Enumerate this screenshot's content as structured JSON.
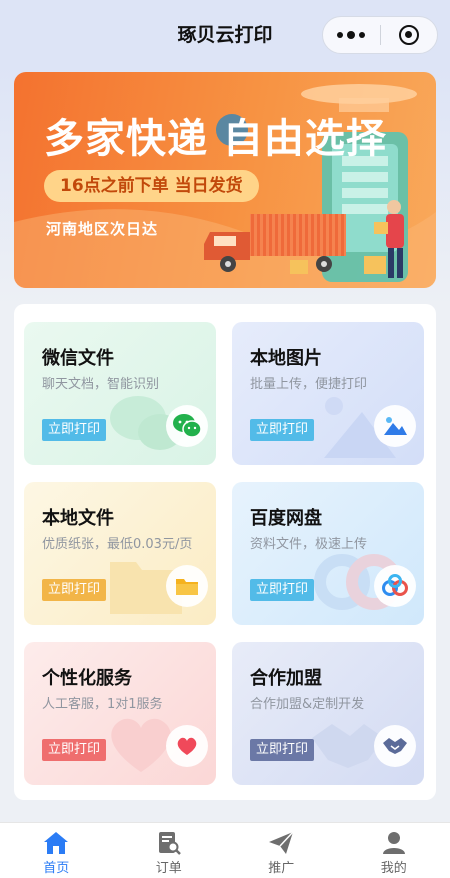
{
  "nav": {
    "title": "琢贝云打印",
    "more_icon": "more-dots-icon",
    "close_icon": "record-circle-icon"
  },
  "banner": {
    "headline": "多家快递 自由选择",
    "pill": "16点之前下单 当日发货",
    "region": "河南地区次日达"
  },
  "services": [
    {
      "title": "微信文件",
      "subtitle": "聊天文档，智能识别",
      "button": "立即打印",
      "icon": "wechat-icon"
    },
    {
      "title": "本地图片",
      "subtitle": "批量上传，便捷打印",
      "button": "立即打印",
      "icon": "image-icon"
    },
    {
      "title": "本地文件",
      "subtitle": "优质纸张，最低0.03元/页",
      "button": "立即打印",
      "icon": "folder-icon"
    },
    {
      "title": "百度网盘",
      "subtitle": "资料文件，极速上传",
      "button": "立即打印",
      "icon": "baidu-netdisk-icon"
    },
    {
      "title": "个性化服务",
      "subtitle": "人工客服，1对1服务",
      "button": "立即打印",
      "icon": "heart-icon"
    },
    {
      "title": "合作加盟",
      "subtitle": "合作加盟&定制开发",
      "button": "立即打印",
      "icon": "handshake-icon"
    }
  ],
  "tabs": [
    {
      "label": "首页",
      "icon": "home-icon",
      "active": true
    },
    {
      "label": "订单",
      "icon": "order-search-icon",
      "active": false
    },
    {
      "label": "推广",
      "icon": "paper-plane-icon",
      "active": false
    },
    {
      "label": "我的",
      "icon": "user-icon",
      "active": false
    }
  ],
  "colors": {
    "accent": "#2b7cf5",
    "banner_orange": "#f4722f",
    "btn_green": "#52bbe8",
    "btn_orange": "#f2b548",
    "btn_red": "#ef6e6e",
    "btn_navy": "#6b78a6"
  }
}
